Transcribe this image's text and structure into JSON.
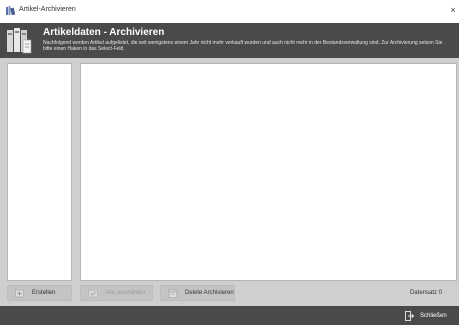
{
  "window": {
    "title": "Artikel-Archivieren",
    "close_glyph": "×",
    "app_icon": "books-icon"
  },
  "header": {
    "title": "Artikeldaten - Archivieren",
    "description": "Nachfolgend werden Artikel aufgelistet, die seit wenigstens einem Jahr nicht mehr verkauft wurden und auch nicht mehr in der Bestandsverwaltung sind. Zur Archivierung setzen Sie bitte einen Haken in das Select-Feld.",
    "icon": "archive-books-icon"
  },
  "toolbar": {
    "create_label": "Erstellen",
    "select_all_label": "Alle auswählen",
    "delete_label": "Delete Archivieren",
    "count_label": "Datensatz 0"
  },
  "footer": {
    "close_label": "Schließen",
    "close_icon": "exit-door-icon"
  },
  "colors": {
    "banner_bg": "#4a4a4a",
    "panel_bg": "#cfcfcf",
    "button_bg": "#c4c4c4"
  }
}
